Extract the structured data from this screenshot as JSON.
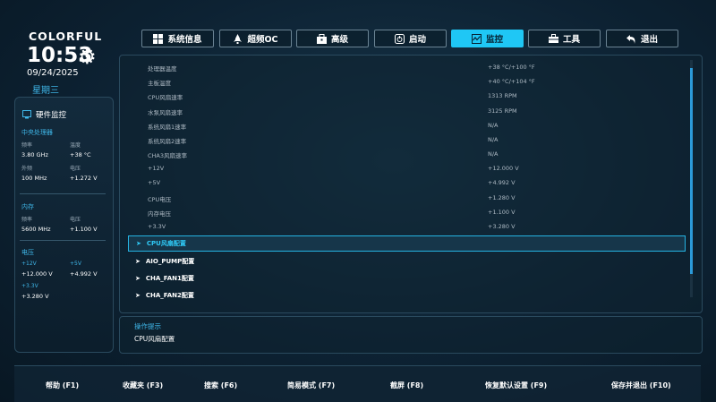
{
  "brand": "COLORFUL",
  "clock": {
    "time": "10:53",
    "date": "09/24/2025",
    "weekday": "星期三"
  },
  "hardware_monitor": {
    "title": "硬件监控",
    "cpu": {
      "title": "中央处理器",
      "freq_label": "频率",
      "freq_value": "3.80 GHz",
      "temp_label": "温度",
      "temp_value": "+38 °C",
      "bclk_label": "外频",
      "bclk_value": "100 MHz",
      "volt_label": "电压",
      "volt_value": "+1.272 V"
    },
    "memory": {
      "title": "内存",
      "freq_label": "频率",
      "freq_value": "5600 MHz",
      "volt_label": "电压",
      "volt_value": "+1.100 V"
    },
    "voltage": {
      "title": "电压",
      "v12_label": "+12V",
      "v12_value": "+12.000 V",
      "v5_label": "+5V",
      "v5_value": "+4.992 V",
      "v33_label": "+3.3V",
      "v33_value": "+3.280 V"
    }
  },
  "tabs": [
    {
      "label": "系统信息",
      "icon": "grid-icon"
    },
    {
      "label": "超频OC",
      "icon": "rocket-icon"
    },
    {
      "label": "高级",
      "icon": "toolbox-icon"
    },
    {
      "label": "启动",
      "icon": "power-icon"
    },
    {
      "label": "监控",
      "icon": "monitor-chart-icon",
      "active": true
    },
    {
      "label": "工具",
      "icon": "briefcase-icon"
    },
    {
      "label": "退出",
      "icon": "return-icon"
    }
  ],
  "readings": [
    {
      "label": "处理器温度",
      "value": "+38 °C/+100 °F"
    },
    {
      "label": "主板温度",
      "value": "+40 °C/+104 °F"
    },
    {
      "label": "CPU风扇速率",
      "value": "1313 RPM"
    },
    {
      "label": "水泵风扇速率",
      "value": "3125 RPM"
    },
    {
      "label": "系统风扇1速率",
      "value": "N/A"
    },
    {
      "label": "系统风扇2速率",
      "value": "N/A"
    },
    {
      "label": "CHA3风扇速率",
      "value": "N/A"
    },
    {
      "label": "+12V",
      "value": "+12.000 V"
    },
    {
      "label": "+5V",
      "value": "+4.992 V"
    },
    {
      "label": "CPU电压",
      "value": "+1.280 V"
    },
    {
      "label": "内存电压",
      "value": "+1.100 V"
    },
    {
      "label": "+3.3V",
      "value": "+3.280 V"
    }
  ],
  "submenus": [
    {
      "label": "CPU风扇配置",
      "selected": true
    },
    {
      "label": "AIO_PUMP配置"
    },
    {
      "label": "CHA_FAN1配置"
    },
    {
      "label": "CHA_FAN2配置"
    }
  ],
  "hint": {
    "title": "操作提示",
    "text": "CPU风扇配置"
  },
  "footer": [
    "帮助 (F1)",
    "收藏夹 (F3)",
    "搜索 (F6)",
    "简易模式 (F7)",
    "截屏 (F8)",
    "恢复默认设置 (F9)",
    "保存并退出 (F10)"
  ],
  "colors": {
    "accent": "#1fc7f5",
    "label_blue": "#3fb6e8",
    "background": "#0d2233"
  }
}
